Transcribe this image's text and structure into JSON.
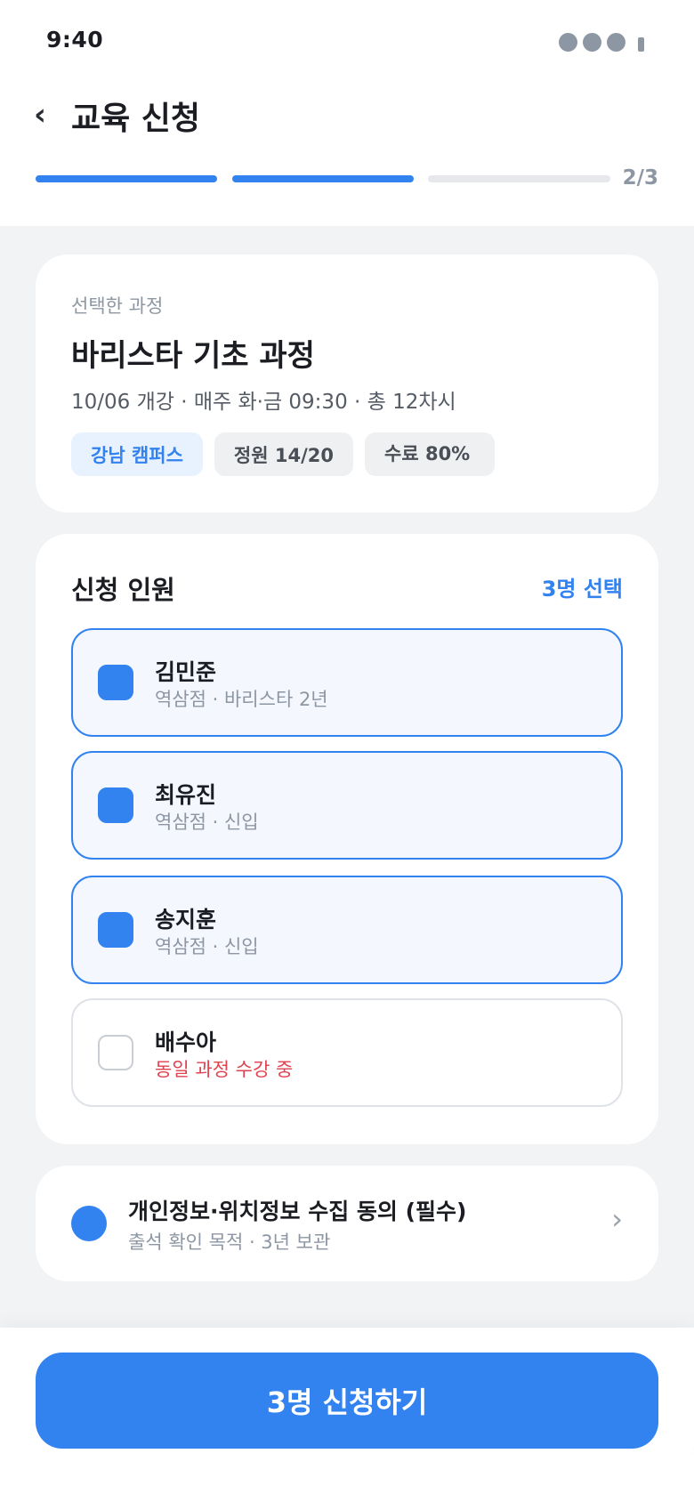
{
  "status_bar": {
    "time": "9:40"
  },
  "header": {
    "back_icon": "‹",
    "title": "교육 신청",
    "step_label": "2/3",
    "progress": {
      "current_step": 2,
      "total_steps": 3
    }
  },
  "course": {
    "label": "선택한 과정",
    "name": "바리스타 기초 과정",
    "meta": "10/06 개강 · 매주 화·금 09:30 · 총 12차시",
    "chips": [
      "강남 캠퍼스",
      "정원 14/20",
      "수료 80%"
    ]
  },
  "members": {
    "title": "신청 인원",
    "selected_count": "3명 선택",
    "items": [
      {
        "name": "김민준",
        "sub": "역삼점 · 바리스타 2년",
        "selected": true,
        "warning": false
      },
      {
        "name": "최유진",
        "sub": "역삼점 · 신입",
        "selected": true,
        "warning": false
      },
      {
        "name": "송지훈",
        "sub": "역삼점 · 신입",
        "selected": true,
        "warning": false
      },
      {
        "name": "배수아",
        "sub": "동일 과정 수강 중",
        "selected": false,
        "warning": true
      }
    ]
  },
  "consent": {
    "title": "개인정보·위치정보 수집 동의 (필수)",
    "sub": "출석 확인 목적 · 3년 보관",
    "chevron": "›"
  },
  "cta": {
    "label": "3명 신청하기"
  },
  "colors": {
    "accent": "#3282f0",
    "warning": "#e0424f",
    "muted": "#8d96a3"
  }
}
